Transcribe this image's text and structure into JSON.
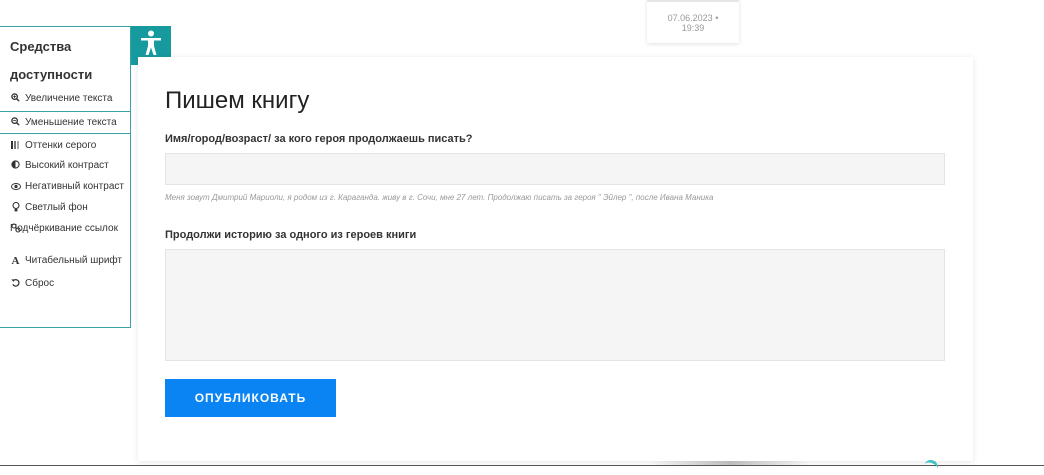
{
  "accessibility": {
    "title_line1": "Средства",
    "title_line2": "доступности",
    "items": [
      {
        "icon": "zoom-in-icon",
        "label": "Увеличение текста"
      },
      {
        "icon": "zoom-out-icon",
        "label": "Уменьшение текста"
      },
      {
        "icon": "grayscale-icon",
        "label": "Оттенки серого"
      },
      {
        "icon": "contrast-icon",
        "label": "Высокий контраст"
      },
      {
        "icon": "eye-icon",
        "label": "Негативный контраст"
      },
      {
        "icon": "bulb-icon",
        "label": "Светлый фон"
      },
      {
        "icon": "link-icon",
        "label": "Подчёркивание ссылок"
      },
      {
        "icon": "font-icon",
        "label": "Читабельный шрифт"
      },
      {
        "icon": "reset-icon",
        "label": "Сброс"
      }
    ],
    "toggle_icon": "accessibility-person-icon"
  },
  "date_badge": {
    "date": "07.06.2023",
    "separator": "•",
    "time": "19:39"
  },
  "form": {
    "title": "Пишем книгу",
    "field1_label": "Имя/город/возраст/ за кого героя продолжаешь писать?",
    "field1_value": "",
    "field1_hint": "Меня зовут Дмитрий Мариоли, я родом из г. Караганда. живу в г. Сочи, мне 27 лет. Продолжаю писать за героя \" Эйлер \", после Ивана Маника",
    "field2_label": "Продолжи историю за одного из героев книги",
    "field2_value": "",
    "submit_label": "ОПУБЛИКОВАТЬ"
  },
  "colors": {
    "accent_teal": "#179a9e",
    "button_blue": "#0a84f2"
  }
}
